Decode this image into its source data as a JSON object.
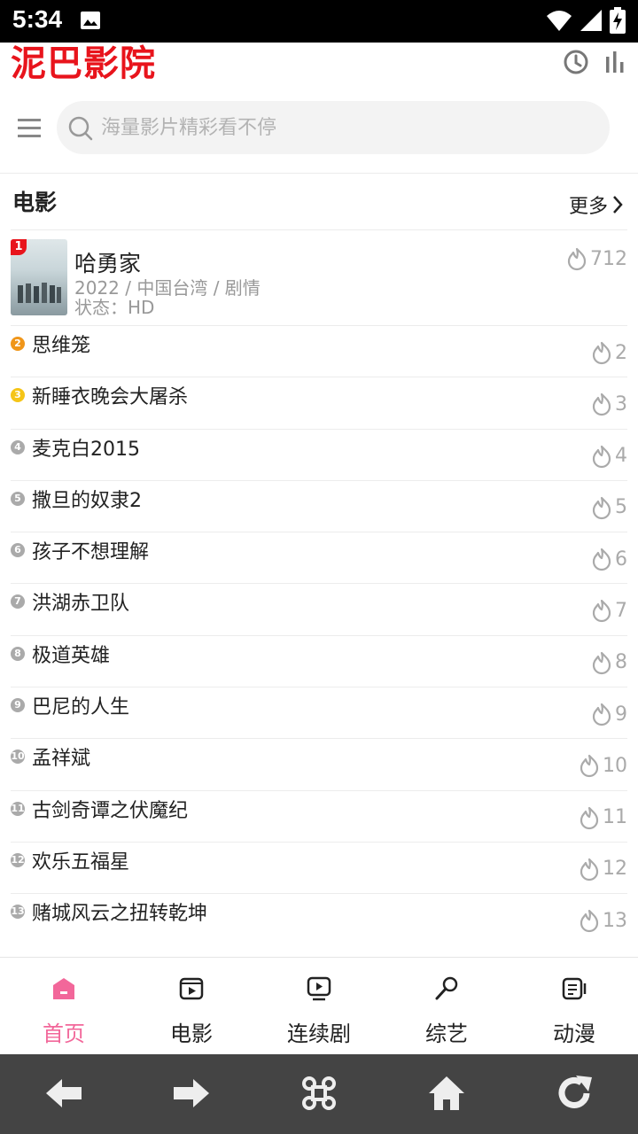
{
  "status_bar": {
    "time": "5:34"
  },
  "app": {
    "title": "泥巴影院"
  },
  "header": {
    "icons": [
      "history-icon",
      "stats-icon"
    ]
  },
  "search": {
    "placeholder": "海量影片精彩看不停"
  },
  "section": {
    "title": "电影",
    "more_label": "更多"
  },
  "top_item": {
    "rank": "1",
    "title": "哈勇家",
    "meta": "2022 / 中国台湾 / 剧情",
    "status": "状态：HD",
    "hot": "712"
  },
  "list": [
    {
      "rank": "2",
      "name": "思维笼",
      "hot": "2",
      "color": "#f0961a"
    },
    {
      "rank": "3",
      "name": "新睡衣晚会大屠杀",
      "hot": "3",
      "color": "#f5c518"
    },
    {
      "rank": "4",
      "name": "麦克白2015",
      "hot": "4",
      "color": "#aaaaaa"
    },
    {
      "rank": "5",
      "name": "撒旦的奴隶2",
      "hot": "5",
      "color": "#aaaaaa"
    },
    {
      "rank": "6",
      "name": "孩子不想理解",
      "hot": "6",
      "color": "#aaaaaa"
    },
    {
      "rank": "7",
      "name": "洪湖赤卫队",
      "hot": "7",
      "color": "#aaaaaa"
    },
    {
      "rank": "8",
      "name": "极道英雄",
      "hot": "8",
      "color": "#aaaaaa"
    },
    {
      "rank": "9",
      "name": "巴尼的人生",
      "hot": "9",
      "color": "#aaaaaa"
    },
    {
      "rank": "10",
      "name": "孟祥斌",
      "hot": "10",
      "color": "#aaaaaa"
    },
    {
      "rank": "11",
      "name": "古剑奇谭之伏魔纪",
      "hot": "11",
      "color": "#aaaaaa"
    },
    {
      "rank": "12",
      "name": "欢乐五福星",
      "hot": "12",
      "color": "#aaaaaa"
    },
    {
      "rank": "13",
      "name": "赌城风云之扭转乾坤",
      "hot": "13",
      "color": "#aaaaaa"
    }
  ],
  "bottom_nav": [
    {
      "label": "首页",
      "icon": "home-icon",
      "active": true
    },
    {
      "label": "电影",
      "icon": "movie-icon",
      "active": false
    },
    {
      "label": "连续剧",
      "icon": "tv-series-icon",
      "active": false
    },
    {
      "label": "综艺",
      "icon": "microphone-icon",
      "active": false
    },
    {
      "label": "动漫",
      "icon": "anime-icon",
      "active": false
    }
  ],
  "browser_bar": {
    "icons": [
      "back-arrow-icon",
      "forward-arrow-icon",
      "command-icon",
      "house-icon",
      "refresh-icon"
    ]
  },
  "colors": {
    "brand": "#e8141c",
    "active_tab": "#f2679a",
    "hot_gray": "#aaaaaa"
  }
}
